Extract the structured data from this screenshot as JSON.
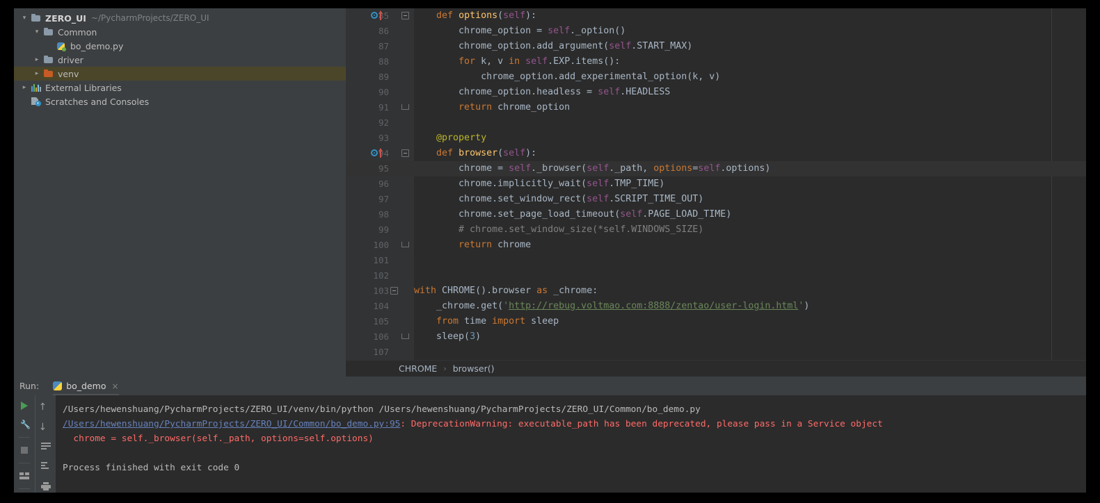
{
  "sidebar": {
    "items": [
      {
        "label": "ZERO_UI",
        "path": "~/PycharmProjects/ZERO_UI",
        "icon": "folder-icon",
        "state": "expanded",
        "depth": 0
      },
      {
        "label": "Common",
        "path": "",
        "icon": "folder-icon",
        "state": "expanded",
        "depth": 1
      },
      {
        "label": "bo_demo.py",
        "path": "",
        "icon": "python-file-icon",
        "state": "leaf",
        "depth": 2
      },
      {
        "label": "driver",
        "path": "",
        "icon": "folder-icon",
        "state": "collapsed",
        "depth": 1
      },
      {
        "label": "venv",
        "path": "",
        "icon": "folder-excluded-icon",
        "state": "collapsed",
        "depth": 1,
        "selected": true
      },
      {
        "label": "External Libraries",
        "path": "",
        "icon": "libraries-icon",
        "state": "collapsed",
        "depth": 0
      },
      {
        "label": "Scratches and Consoles",
        "path": "",
        "icon": "scratches-icon",
        "state": "leaf",
        "depth": 0
      }
    ]
  },
  "editor": {
    "caret_line": 95,
    "lines": [
      {
        "n": 85,
        "segments": [
          {
            "t": "    ",
            "c": "p"
          },
          {
            "t": "def ",
            "c": "kw"
          },
          {
            "t": "options",
            "c": "fn"
          },
          {
            "t": "(",
            "c": "p"
          },
          {
            "t": "self",
            "c": "sf"
          },
          {
            "t": "):",
            "c": "p"
          }
        ],
        "gutter": "override-marker",
        "fold": "start"
      },
      {
        "n": 86,
        "segments": [
          {
            "t": "        chrome_option = ",
            "c": "p"
          },
          {
            "t": "self",
            "c": "sf"
          },
          {
            "t": "._option()",
            "c": "p"
          }
        ]
      },
      {
        "n": 87,
        "segments": [
          {
            "t": "        chrome_option.add_argument(",
            "c": "p"
          },
          {
            "t": "self",
            "c": "sf"
          },
          {
            "t": ".START_MAX)",
            "c": "p"
          }
        ]
      },
      {
        "n": 88,
        "segments": [
          {
            "t": "        ",
            "c": "p"
          },
          {
            "t": "for ",
            "c": "kw"
          },
          {
            "t": "k, v ",
            "c": "p"
          },
          {
            "t": "in ",
            "c": "kw"
          },
          {
            "t": "self",
            "c": "sf"
          },
          {
            "t": ".EXP.items():",
            "c": "p"
          }
        ]
      },
      {
        "n": 89,
        "segments": [
          {
            "t": "            chrome_option.add_experimental_option(k, v)",
            "c": "p"
          }
        ]
      },
      {
        "n": 90,
        "segments": [
          {
            "t": "        chrome_option.headless = ",
            "c": "p"
          },
          {
            "t": "self",
            "c": "sf"
          },
          {
            "t": ".HEADLESS",
            "c": "p"
          }
        ]
      },
      {
        "n": 91,
        "segments": [
          {
            "t": "        ",
            "c": "p"
          },
          {
            "t": "return ",
            "c": "kw"
          },
          {
            "t": "chrome_option",
            "c": "p"
          }
        ],
        "fold": "end"
      },
      {
        "n": 92,
        "segments": []
      },
      {
        "n": 93,
        "segments": [
          {
            "t": "    ",
            "c": "p"
          },
          {
            "t": "@property",
            "c": "dec"
          }
        ]
      },
      {
        "n": 94,
        "segments": [
          {
            "t": "    ",
            "c": "p"
          },
          {
            "t": "def ",
            "c": "kw"
          },
          {
            "t": "browser",
            "c": "fn"
          },
          {
            "t": "(",
            "c": "p"
          },
          {
            "t": "self",
            "c": "sf"
          },
          {
            "t": "):",
            "c": "p"
          }
        ],
        "gutter": "override-marker",
        "fold": "start"
      },
      {
        "n": 95,
        "segments": [
          {
            "t": "        chrome = ",
            "c": "p"
          },
          {
            "t": "self",
            "c": "sf"
          },
          {
            "t": "._browser(",
            "c": "p"
          },
          {
            "t": "self",
            "c": "sf"
          },
          {
            "t": "._path, ",
            "c": "p"
          },
          {
            "t": "options",
            "c": "param"
          },
          {
            "t": "=",
            "c": "p"
          },
          {
            "t": "self",
            "c": "sf"
          },
          {
            "t": ".options)",
            "c": "p"
          }
        ]
      },
      {
        "n": 96,
        "segments": [
          {
            "t": "        chrome.implicitly_wait(",
            "c": "p"
          },
          {
            "t": "self",
            "c": "sf"
          },
          {
            "t": ".TMP_TIME)",
            "c": "p"
          }
        ]
      },
      {
        "n": 97,
        "segments": [
          {
            "t": "        chrome.set_window_rect(",
            "c": "p"
          },
          {
            "t": "self",
            "c": "sf"
          },
          {
            "t": ".SCRIPT_TIME_OUT)",
            "c": "p"
          }
        ]
      },
      {
        "n": 98,
        "segments": [
          {
            "t": "        chrome.set_page_load_timeout(",
            "c": "p"
          },
          {
            "t": "self",
            "c": "sf"
          },
          {
            "t": ".PAGE_LOAD_TIME)",
            "c": "p"
          }
        ]
      },
      {
        "n": 99,
        "segments": [
          {
            "t": "        # chrome.set_window_size(*self.WINDOWS_SIZE)",
            "c": "cm"
          }
        ]
      },
      {
        "n": 100,
        "segments": [
          {
            "t": "        ",
            "c": "p"
          },
          {
            "t": "return ",
            "c": "kw"
          },
          {
            "t": "chrome",
            "c": "p"
          }
        ],
        "fold": "end"
      },
      {
        "n": 101,
        "segments": []
      },
      {
        "n": 102,
        "segments": []
      },
      {
        "n": 103,
        "segments": [
          {
            "t": "with ",
            "c": "kw"
          },
          {
            "t": "CHROME().browser ",
            "c": "p"
          },
          {
            "t": "as ",
            "c": "kw"
          },
          {
            "t": "_chrome:",
            "c": "p"
          }
        ],
        "fold": "start-root"
      },
      {
        "n": 104,
        "segments": [
          {
            "t": "    _chrome.get(",
            "c": "p"
          },
          {
            "t": "'",
            "c": "str"
          },
          {
            "t": "http://rebug.voltmao.com:8888/zentao/user-login.html",
            "c": "url"
          },
          {
            "t": "'",
            "c": "str"
          },
          {
            "t": ")",
            "c": "p"
          }
        ]
      },
      {
        "n": 105,
        "segments": [
          {
            "t": "    ",
            "c": "p"
          },
          {
            "t": "from ",
            "c": "kw"
          },
          {
            "t": "time ",
            "c": "p"
          },
          {
            "t": "import ",
            "c": "kw"
          },
          {
            "t": "sleep",
            "c": "p"
          }
        ]
      },
      {
        "n": 106,
        "segments": [
          {
            "t": "    sleep(",
            "c": "p"
          },
          {
            "t": "3",
            "c": "num"
          },
          {
            "t": ")",
            "c": "p"
          }
        ],
        "fold": "end-root"
      },
      {
        "n": 107,
        "segments": []
      }
    ],
    "breadcrumb": [
      "CHROME",
      "browser()"
    ],
    "breadcrumb_separator": "›"
  },
  "run_panel": {
    "label": "Run:",
    "tab_name": "bo_demo",
    "close_label": "×",
    "tools_left": [
      "rerun-icon",
      "settings-wrench-icon",
      "stop-icon",
      "layout-icon"
    ],
    "tools_right": [
      "scroll-up-icon",
      "scroll-down-icon",
      "soft-wrap-icon",
      "scroll-to-end-icon",
      "print-icon"
    ],
    "console": [
      {
        "parts": [
          {
            "t": "/Users/hewenshuang/PycharmProjects/ZERO_UI/venv/bin/python /Users/hewenshuang/PycharmProjects/ZERO_UI/Common/bo_demo.py",
            "c": "plain"
          }
        ]
      },
      {
        "parts": [
          {
            "t": "/Users/hewenshuang/PycharmProjects/ZERO_UI/Common/bo_demo.py:95",
            "c": "link"
          },
          {
            "t": ": DeprecationWarning: executable_path has been deprecated, please pass in a Service object",
            "c": "err"
          }
        ]
      },
      {
        "parts": [
          {
            "t": "  chrome = self._browser(self._path, options=self.options)",
            "c": "err"
          }
        ]
      },
      {
        "parts": [
          {
            "t": " ",
            "c": "plain"
          }
        ]
      },
      {
        "parts": [
          {
            "t": "Process finished with exit code 0",
            "c": "plain"
          }
        ]
      }
    ]
  },
  "colors": {
    "editor_bg": "#2b2b2b",
    "panel_bg": "#3c3f41",
    "gutter_bg": "#313335",
    "selection": "#4b4629",
    "keyword": "#cc7832",
    "function": "#ffc66d",
    "self": "#94558d",
    "string": "#6a8759",
    "comment": "#808080",
    "decorator": "#bbb529",
    "number": "#6897bb",
    "error": "#ff6b68",
    "link": "#6782bd"
  }
}
